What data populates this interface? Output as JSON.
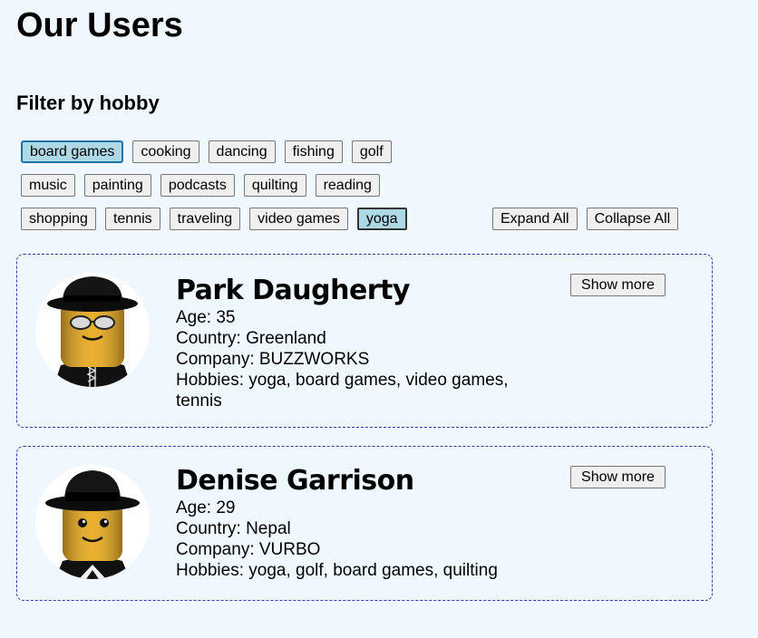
{
  "page": {
    "title": "Our Users"
  },
  "filter": {
    "title": "Filter by hobby",
    "rows": [
      [
        {
          "label": "board games",
          "state": "focused-selected"
        },
        {
          "label": "cooking",
          "state": ""
        },
        {
          "label": "dancing",
          "state": ""
        },
        {
          "label": "fishing",
          "state": ""
        },
        {
          "label": "golf",
          "state": ""
        }
      ],
      [
        {
          "label": "music",
          "state": ""
        },
        {
          "label": "painting",
          "state": ""
        },
        {
          "label": "podcasts",
          "state": ""
        },
        {
          "label": "quilting",
          "state": ""
        },
        {
          "label": "reading",
          "state": ""
        }
      ],
      [
        {
          "label": "shopping",
          "state": ""
        },
        {
          "label": "tennis",
          "state": ""
        },
        {
          "label": "traveling",
          "state": ""
        },
        {
          "label": "video games",
          "state": ""
        },
        {
          "label": "yoga",
          "state": "selected"
        }
      ]
    ]
  },
  "controls": {
    "expand_all": "Expand All",
    "collapse_all": "Collapse All"
  },
  "users": [
    {
      "name": "Park Daugherty",
      "age": "Age: 35",
      "country": "Country: Greenland",
      "company": "Company: BUZZWORKS",
      "hobbies_line1": "Hobbies: yoga, board games, video games,",
      "hobbies_line2": "tennis",
      "show_more": "Show more"
    },
    {
      "name": "Denise Garrison",
      "age": "Age: 29",
      "country": "Country: Nepal",
      "company": "Company: VURBO",
      "hobbies_line1": "Hobbies: yoga, golf, board games, quilting",
      "show_more": "Show more"
    }
  ]
}
